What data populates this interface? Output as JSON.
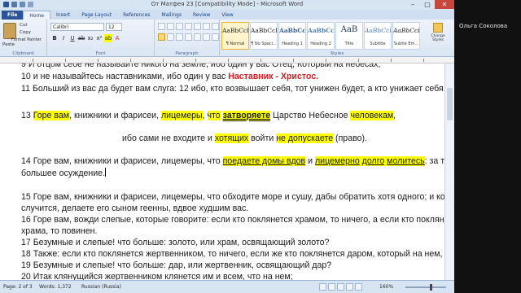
{
  "app": {
    "title": "От Матфея 23 [Compatibility Mode] - Microsoft Word",
    "tabs": [
      "File",
      "Home",
      "Insert",
      "Page Layout",
      "References",
      "Mailings",
      "Review",
      "View"
    ],
    "active_tab": "Home"
  },
  "ribbon": {
    "clipboard": {
      "label": "Clipboard",
      "paste": "Paste",
      "cut": "Cut",
      "copy": "Copy",
      "format_painter": "Format Painter"
    },
    "font": {
      "label": "Font",
      "name": "Calibri",
      "size": "12"
    },
    "paragraph": {
      "label": "Paragraph"
    },
    "styles": {
      "label": "Styles",
      "items": [
        {
          "sample": "AaBbCcDc",
          "name": "¶ Normal"
        },
        {
          "sample": "AaBbCcDc",
          "name": "¶ No Spaci..."
        },
        {
          "sample": "AaBbCc",
          "name": "Heading 1"
        },
        {
          "sample": "AaBbCc",
          "name": "Heading 2"
        },
        {
          "sample": "AaB",
          "name": "Title"
        },
        {
          "sample": "AaBbCcI",
          "name": "Subtitle"
        },
        {
          "sample": "AaBbCcDc",
          "name": "Subtle Em..."
        }
      ],
      "change": "Change Styles"
    }
  },
  "document": {
    "lines": {
      "l9": "9 И отцом себе не называйте никого на земле, ибо один у вас Отец, Который на небесах;",
      "l10a": "10 и не называйтесь наставниками, ибо один у вас ",
      "l10b": "Наставник - Христос.",
      "l11": "11 Больший из вас да будет вам слуга: 12 ибо, кто возвышает себя, тот унижен будет, а кто унижает себя, тот возвысится.",
      "l13a": "13 ",
      "l13b": "Горе вам",
      "l13c": ", книжники и фарисеи, ",
      "l13d": "лицемеры",
      "l13e": ", ",
      "l13f": "что",
      "l13g": " ",
      "l13h": "затворяете",
      "l13i": "   Царство Небесное  ",
      "l13j": " человекам",
      "l13k": ",",
      "l13la": "ибо сами не входите и ",
      "l13lb": "хотящих",
      "l13lc": " войти ",
      "l13ld": "не допускаете",
      "l13le": " (право).",
      "l14a": "14 Горе вам, книжники и фарисеи, лицемеры, что ",
      "l14b": "поедаете домы вдов",
      "l14c": " и ",
      "l14d": "лицемерно",
      "l14e": " ",
      "l14f": "долго",
      "l14g": " ",
      "l14h": "молитесь",
      "l14i": ": за то примете тем",
      "l14j": "большее осуждение.",
      "l15": "15 Горе вам, книжники и фарисеи, лицемеры, что обходите море и сушу, дабы обратить хотя одного; и когда это",
      "l15b": "случится, делаете его сыном геенны, вдвое худшим вас.",
      "l16": "16 Горе вам, вожди слепые, которые говорите: если кто поклянется храмом, то ничего, а если кто поклянется золотом",
      "l16b": "храма, то повинен.",
      "l17": "17 Безумные и слепые! что больше: золото, или храм, освящающий золото?",
      "l18": "18 Также: если кто поклянется жертвенником, то ничего, если же кто поклянется даром, который на нем, то повинен.",
      "l19": "19 Безумные и слепые! что больше: дар, или жертвенник, освящающий дар?",
      "l20": "20 Итак клянущийся жертвенником клянется им и всем, что на нем;"
    }
  },
  "status": {
    "page": "Page: 2 of 3",
    "words": "Words: 1,372",
    "language": "Russian (Russia)",
    "zoom": "160%"
  },
  "participant": {
    "name": "Ольга Соколова"
  },
  "colors": {
    "highlight": "#ffff00",
    "red_text": "#e01b1b",
    "ribbon_bg": "#dbe6f4",
    "file_tab": "#2a5699"
  }
}
